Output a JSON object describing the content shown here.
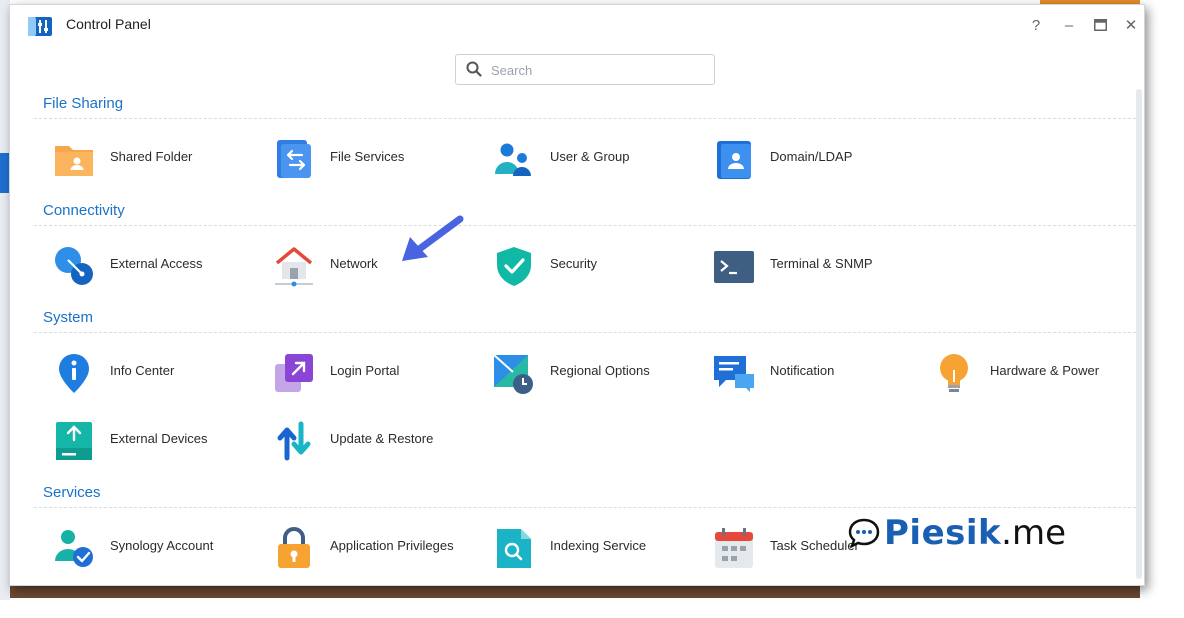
{
  "window": {
    "title": "Control Panel",
    "help_label": "?",
    "minimize_label": "–",
    "close_label": "✕"
  },
  "search": {
    "placeholder": "Search",
    "value": ""
  },
  "sections": [
    {
      "title": "File Sharing",
      "items": [
        {
          "label": "Shared Folder",
          "icon": "shared-folder-icon"
        },
        {
          "label": "File Services",
          "icon": "file-services-icon"
        },
        {
          "label": "User & Group",
          "icon": "user-group-icon"
        },
        {
          "label": "Domain/LDAP",
          "icon": "domain-ldap-icon"
        }
      ]
    },
    {
      "title": "Connectivity",
      "items": [
        {
          "label": "External Access",
          "icon": "external-access-icon"
        },
        {
          "label": "Network",
          "icon": "network-icon"
        },
        {
          "label": "Security",
          "icon": "security-shield-icon"
        },
        {
          "label": "Terminal & SNMP",
          "icon": "terminal-icon"
        }
      ]
    },
    {
      "title": "System",
      "items": [
        {
          "label": "Info Center",
          "icon": "info-center-icon"
        },
        {
          "label": "Login Portal",
          "icon": "login-portal-icon"
        },
        {
          "label": "Regional Options",
          "icon": "regional-options-icon"
        },
        {
          "label": "Notification",
          "icon": "notification-icon"
        },
        {
          "label": "Hardware & Power",
          "icon": "hardware-power-icon"
        },
        {
          "label": "External Devices",
          "icon": "external-devices-icon"
        },
        {
          "label": "Update & Restore",
          "icon": "update-restore-icon"
        }
      ]
    },
    {
      "title": "Services",
      "items": [
        {
          "label": "Synology Account",
          "icon": "synology-account-icon"
        },
        {
          "label": "Application Privileges",
          "icon": "application-privileges-icon"
        },
        {
          "label": "Indexing Service",
          "icon": "indexing-service-icon"
        },
        {
          "label": "Task Scheduler",
          "icon": "task-scheduler-icon"
        }
      ]
    }
  ],
  "watermark": {
    "brand": "Piesik",
    "suffix": ".me"
  },
  "colors": {
    "section_title": "#1a73c9",
    "annotation_arrow": "#4a63e0",
    "watermark": "#1a5fb4"
  }
}
